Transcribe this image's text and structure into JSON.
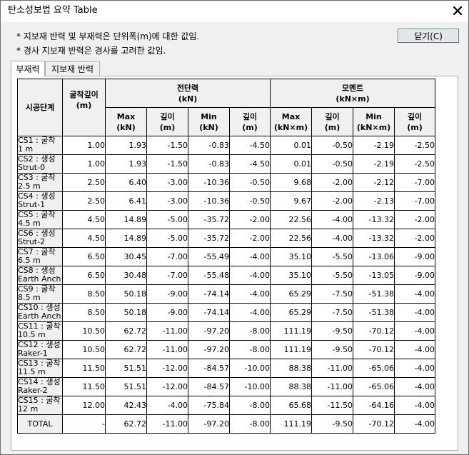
{
  "window": {
    "title": "탄소성보법 요약 Table"
  },
  "notes": [
    "* 지보재 반력 및 부재력은 단위폭(m)에 대한 값임.",
    "* 경사 지보재 반력은 경사를 고려한 값임."
  ],
  "close_button": {
    "label": "닫기(C)"
  },
  "tabs": [
    {
      "label": "부재력",
      "active": true
    },
    {
      "label": "지보재 반력",
      "active": false
    }
  ],
  "table": {
    "headers": {
      "stage": "시공단계",
      "depth": "굴착깊이\n(m)",
      "shear_group": "전단력\n(kN)",
      "moment_group": "모멘트\n(kN×m)",
      "shear_cols": [
        "Max\n(kN)",
        "깊이\n(m)",
        "Min\n(kN)",
        "깊이\n(m)"
      ],
      "moment_cols": [
        "Max\n(kN×m)",
        "깊이\n(m)",
        "Min\n(kN×m)",
        "깊이\n(m)"
      ]
    },
    "rows": [
      [
        "CS1 : 굴착 1 m",
        "1.00",
        "1.93",
        "-1.50",
        "-0.83",
        "-4.50",
        "0.01",
        "-0.50",
        "-2.19",
        "-2.50"
      ],
      [
        "CS2 : 생성 Strut-0",
        "1.00",
        "1.93",
        "-1.50",
        "-0.83",
        "-4.50",
        "0.01",
        "-0.50",
        "-2.19",
        "-2.50"
      ],
      [
        "CS3 : 굴착 2.5 m",
        "2.50",
        "6.40",
        "-3.00",
        "-10.36",
        "-0.50",
        "9.68",
        "-2.00",
        "-2.12",
        "-7.00"
      ],
      [
        "CS4 : 생성 Strut-1",
        "2.50",
        "6.41",
        "-3.00",
        "-10.36",
        "-0.50",
        "9.67",
        "-2.00",
        "-2.13",
        "-7.00"
      ],
      [
        "CS5 : 굴착 4.5 m",
        "4.50",
        "14.89",
        "-5.00",
        "-35.72",
        "-2.00",
        "22.56",
        "-4.00",
        "-13.32",
        "-2.00"
      ],
      [
        "CS6 : 생성 Strut-2",
        "4.50",
        "14.89",
        "-5.00",
        "-35.72",
        "-2.00",
        "22.56",
        "-4.00",
        "-13.32",
        "-2.00"
      ],
      [
        "CS7 : 굴착 6.5 m",
        "6.50",
        "30.45",
        "-7.00",
        "-55.49",
        "-4.00",
        "35.10",
        "-5.50",
        "-13.06",
        "-9.00"
      ],
      [
        "CS8 : 생성 Earth Anchor",
        "6.50",
        "30.48",
        "-7.00",
        "-55.48",
        "-4.00",
        "35.10",
        "-5.50",
        "-13.05",
        "-9.00"
      ],
      [
        "CS9 : 굴착 8.5 m",
        "8.50",
        "50.18",
        "-9.00",
        "-74.14",
        "-4.00",
        "65.29",
        "-7.50",
        "-51.38",
        "-4.00"
      ],
      [
        "CS10 : 생성 Earth Anchor",
        "8.50",
        "50.18",
        "-9.00",
        "-74.14",
        "-4.00",
        "65.29",
        "-7.50",
        "-51.38",
        "-4.00"
      ],
      [
        "CS11 : 굴착 10.5 m",
        "10.50",
        "62.72",
        "-11.00",
        "-97.20",
        "-8.00",
        "111.19",
        "-9.50",
        "-70.12",
        "-4.00"
      ],
      [
        "CS12 : 생성 Raker-1",
        "10.50",
        "62.72",
        "-11.00",
        "-97.20",
        "-8.00",
        "111.19",
        "-9.50",
        "-70.12",
        "-4.00"
      ],
      [
        "CS13 : 굴착 11.5 m",
        "11.50",
        "51.51",
        "-12.00",
        "-84.57",
        "-10.00",
        "88.38",
        "-11.00",
        "-65.06",
        "-4.00"
      ],
      [
        "CS14 : 생성 Raker-2",
        "11.50",
        "51.51",
        "-12.00",
        "-84.57",
        "-10.00",
        "88.38",
        "-11.00",
        "-65.06",
        "-4.00"
      ],
      [
        "CS15 : 굴착 12 m",
        "12.00",
        "42.43",
        "-4.00",
        "-75.84",
        "-8.00",
        "65.68",
        "-11.50",
        "-64.16",
        "-4.00"
      ]
    ],
    "total_row": [
      "TOTAL",
      "-",
      "62.72",
      "-11.00",
      "-97.20",
      "-8.00",
      "111.19",
      "-9.50",
      "-70.12",
      "-4.00"
    ]
  }
}
